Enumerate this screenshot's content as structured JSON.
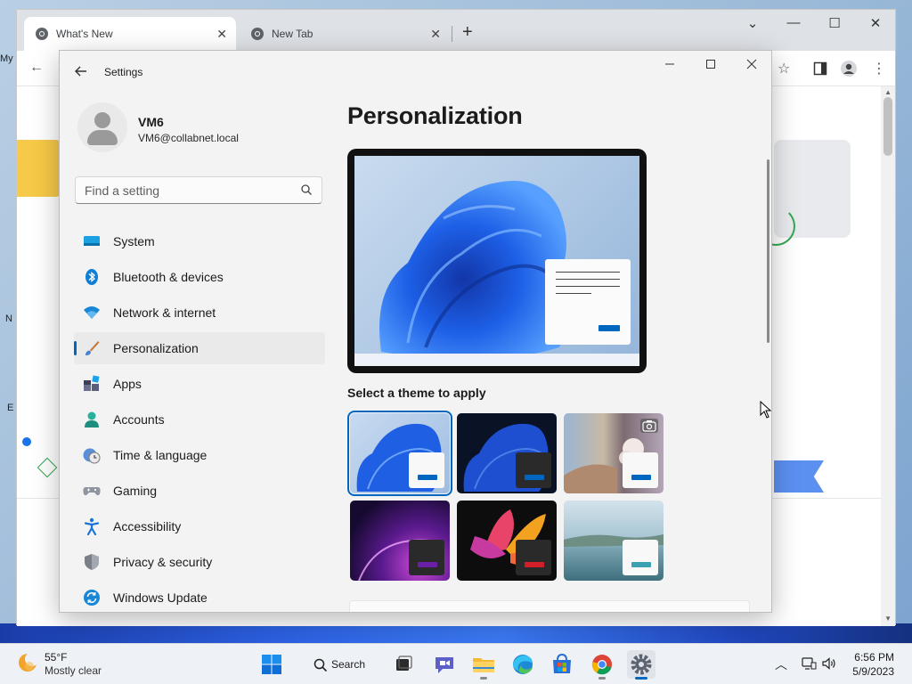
{
  "browser": {
    "tabs": [
      {
        "title": "What's New",
        "active": true
      },
      {
        "title": "New Tab",
        "active": false
      }
    ],
    "new_tab_symbol": "+",
    "controls": {
      "dropdown": "⌄",
      "minimize": "—",
      "maximize": "☐",
      "close": "✕"
    }
  },
  "desktop_edge_text": [
    "My",
    "N",
    "E"
  ],
  "settings": {
    "window_title": "Settings",
    "profile": {
      "name": "VM6",
      "email": "VM6@collabnet.local"
    },
    "search": {
      "placeholder": "Find a setting"
    },
    "nav": [
      {
        "label": "System",
        "icon": "system-icon",
        "selected": false
      },
      {
        "label": "Bluetooth & devices",
        "icon": "bluetooth-icon",
        "selected": false
      },
      {
        "label": "Network & internet",
        "icon": "wifi-icon",
        "selected": false
      },
      {
        "label": "Personalization",
        "icon": "brush-icon",
        "selected": true
      },
      {
        "label": "Apps",
        "icon": "apps-icon",
        "selected": false
      },
      {
        "label": "Accounts",
        "icon": "accounts-icon",
        "selected": false
      },
      {
        "label": "Time & language",
        "icon": "clock-globe-icon",
        "selected": false
      },
      {
        "label": "Gaming",
        "icon": "gamepad-icon",
        "selected": false
      },
      {
        "label": "Accessibility",
        "icon": "accessibility-icon",
        "selected": false
      },
      {
        "label": "Privacy & security",
        "icon": "shield-icon",
        "selected": false
      },
      {
        "label": "Windows Update",
        "icon": "update-icon",
        "selected": false
      }
    ],
    "page_title": "Personalization",
    "themes_label": "Select a theme to apply",
    "themes": [
      {
        "name": "windows-light",
        "selected": true,
        "accent": "#0067c0"
      },
      {
        "name": "windows-dark",
        "selected": false,
        "accent": "#0067c0"
      },
      {
        "name": "windows-spotlight",
        "selected": false,
        "accent": "#0067c0"
      },
      {
        "name": "glow",
        "selected": false,
        "accent": "#6b1fa8"
      },
      {
        "name": "captured-motion",
        "selected": false,
        "accent": "#d21f2a"
      },
      {
        "name": "flow",
        "selected": false,
        "accent": "#3aa0b2"
      }
    ]
  },
  "taskbar": {
    "weather": {
      "temp": "55°F",
      "desc": "Mostly clear"
    },
    "search_label": "Search",
    "apps": [
      "start-icon",
      "search-icon",
      "task-view-icon",
      "chat-icon",
      "file-explorer-icon",
      "edge-icon",
      "store-icon",
      "chrome-icon",
      "settings-icon"
    ],
    "active_app": "settings-icon",
    "clock": {
      "time": "6:56 PM",
      "date": "5/9/2023"
    }
  },
  "colors": {
    "accent": "#0067c0",
    "selection_bg": "#eaeaea",
    "settings_bg": "#f3f3f3"
  }
}
